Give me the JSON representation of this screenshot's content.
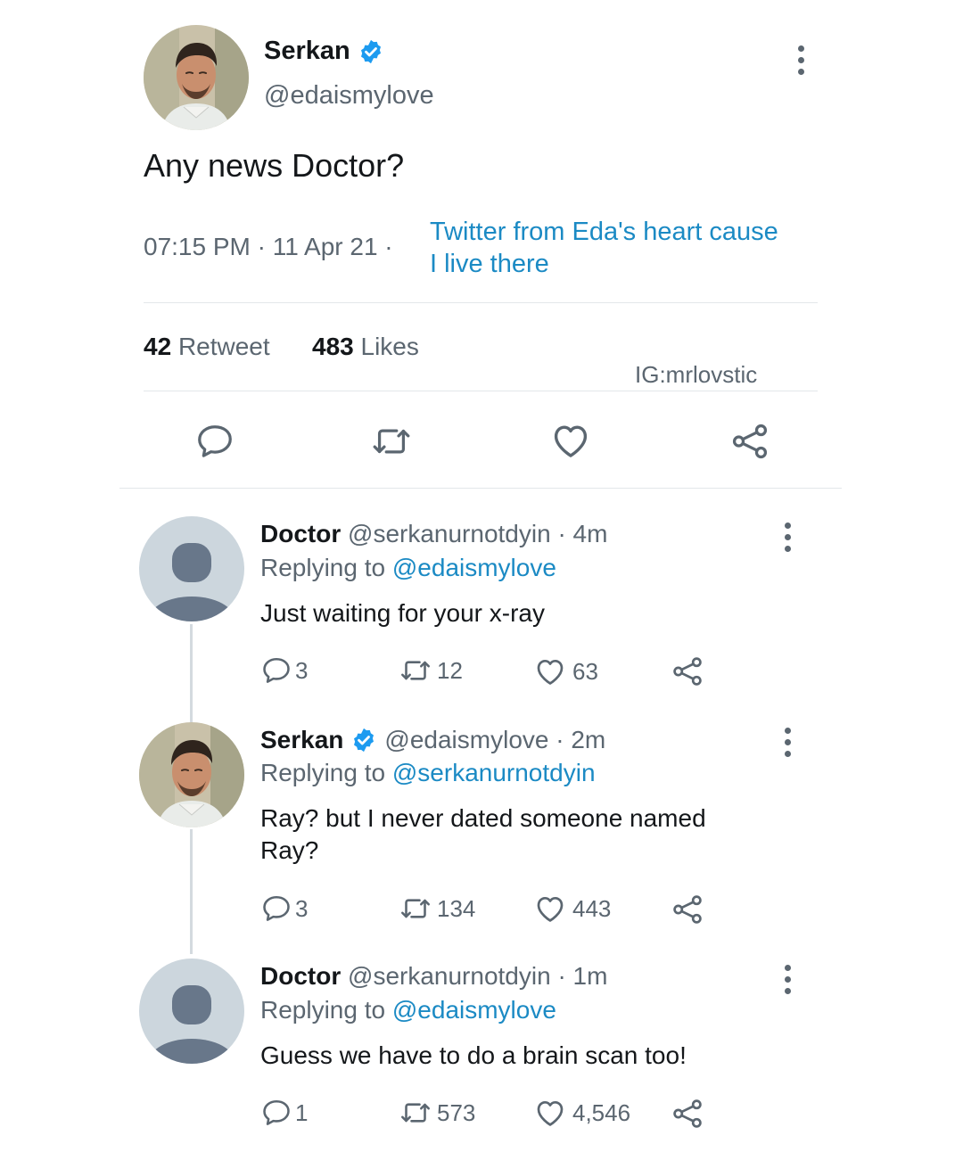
{
  "main_tweet": {
    "author_name": "Serkan",
    "author_handle": "@edaismylove",
    "text": "Any news Doctor?",
    "time": "07:15 PM · 11 Apr 21 ·",
    "source_line1": "Twitter from Eda's heart cause",
    "source_line2": "I live there",
    "retweet_count": "42",
    "retweet_label": "Retweet",
    "likes_count": "483",
    "likes_label": "Likes",
    "watermark": "IG:mrlovstic",
    "icons": [
      "comment-icon",
      "retweet-icon",
      "heart-icon",
      "share-icon"
    ]
  },
  "replies": [
    {
      "name": "Doctor",
      "handle_time": "@serkanurnotdyin · 4m",
      "replying_prefix": "Replying to",
      "replying_to": "@edaismylove",
      "text_line1": "Just waiting for your x-ray",
      "text_line2": "",
      "comments": "3",
      "retweets": "12",
      "likes": "63"
    },
    {
      "name": "Serkan",
      "handle_time": "@edaismylove · 2m",
      "replying_prefix": "Replying to",
      "replying_to": "@serkanurnotdyin",
      "text_line1": "Ray? but I never dated someone named",
      "text_line2": "Ray?",
      "comments": "3",
      "retweets": "134",
      "likes": "443"
    },
    {
      "name": "Doctor",
      "handle_time": "@serkanurnotdyin · 1m",
      "replying_prefix": "Replying to",
      "replying_to": "@edaismylove",
      "text_line1": "Guess we have to do a brain scan too!",
      "text_line2": "",
      "comments": "1",
      "retweets": "573",
      "likes": "4,546"
    }
  ],
  "colors": {
    "link_blue": "#1b8ac4",
    "verified_blue": "#1d9bf0",
    "gray_text": "#5b6670",
    "default_avatar_bg": "#ccd6dd",
    "default_avatar_fg": "#68778a"
  }
}
